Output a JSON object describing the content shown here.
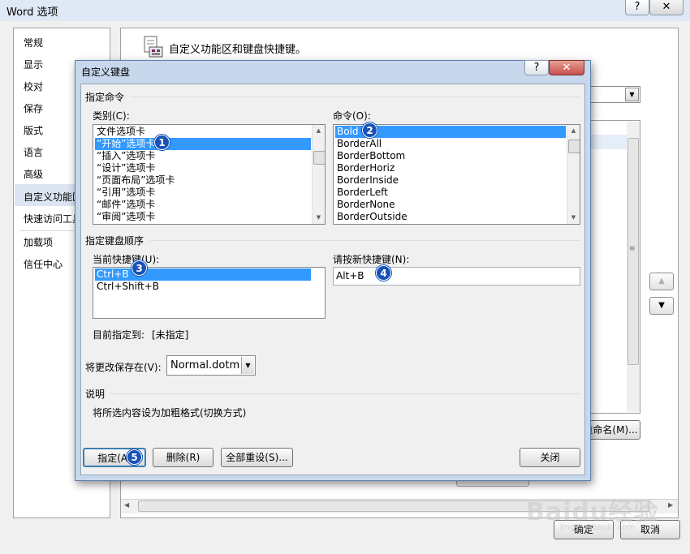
{
  "outer": {
    "title": "Word 选项",
    "help_button": "?",
    "close_button": "✕",
    "nav_items": [
      "常规",
      "显示",
      "校对",
      "保存",
      "版式",
      "语言",
      "高级",
      "自定义功能区",
      "快速访问工具栏",
      "加载项",
      "信任中心"
    ],
    "heading": "自定义功能区和键盘快捷键。",
    "rename_button": "重命名(M)...",
    "ok_button": "确定",
    "cancel_button": "取消"
  },
  "dialog": {
    "title": "自定义键盘",
    "help_button": "?",
    "close_button": "✕",
    "specify_command_group": "指定命令",
    "categories_label": "类别(C):",
    "categories": [
      "文件选项卡",
      "“开始”选项卡",
      "“插入”选项卡",
      "“设计”选项卡",
      "“页面布局”选项卡",
      "“引用”选项卡",
      "“邮件”选项卡",
      "“审阅”选项卡"
    ],
    "commands_label": "命令(O):",
    "commands": [
      "Bold",
      "BorderAll",
      "BorderBottom",
      "BorderHoriz",
      "BorderInside",
      "BorderLeft",
      "BorderNone",
      "BorderOutside"
    ],
    "keyboard_sequence_group": "指定键盘顺序",
    "current_keys_label": "当前快捷键(U):",
    "current_keys": [
      "Ctrl+B",
      "Ctrl+Shift+B"
    ],
    "new_key_label": "请按新快捷键(N):",
    "new_key_value": "Alt+B",
    "currently_assigned_label": "目前指定到:",
    "currently_assigned_value": "[未指定]",
    "save_in_label": "将更改保存在(V):",
    "save_in_value": "Normal.dotm",
    "description_group": "说明",
    "description_text": "将所选内容设为加粗格式(切换方式)",
    "assign_button": "指定(A)",
    "remove_button": "删除(R)",
    "reset_all_button": "全部重设(S)...",
    "close_dialog_button": "关闭"
  },
  "badges": [
    "1",
    "2",
    "3",
    "4",
    "5"
  ],
  "watermark": {
    "text": "Baidu经验",
    "sub": "jingyan.baidu.com"
  },
  "colors": {
    "selection": "#3399ff",
    "badge": "#1652b7",
    "dialog_frame": "#c7d8ec"
  }
}
